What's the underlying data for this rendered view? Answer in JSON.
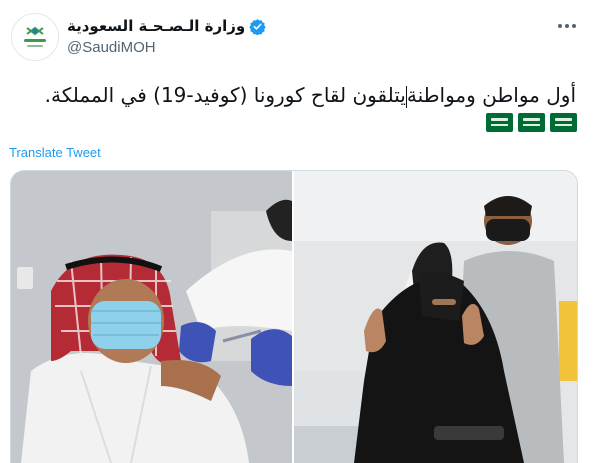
{
  "account": {
    "display_name": "وزارة الـصـحـة السعودية",
    "handle": "@SaudiMOH",
    "avatar_icon": "moh-logo",
    "verified_icon": "verified-badge-icon"
  },
  "tweet": {
    "text_part1": "أول مواطن ومواطنة",
    "text_part2": "يتلقون لقاح كورونا (كوفيد-19) في المملكة.",
    "flags": [
      "saudi-flag",
      "saudi-flag",
      "saudi-flag"
    ],
    "translate_label": "Translate Tweet"
  },
  "media": {
    "photos": [
      {
        "name": "photo-man-vaccinated"
      },
      {
        "name": "photo-woman-thumbs-up"
      }
    ]
  },
  "colors": {
    "link": "#1d9bf0",
    "text": "#0f1419",
    "secondary": "#536471",
    "flag_green": "#006c35"
  }
}
